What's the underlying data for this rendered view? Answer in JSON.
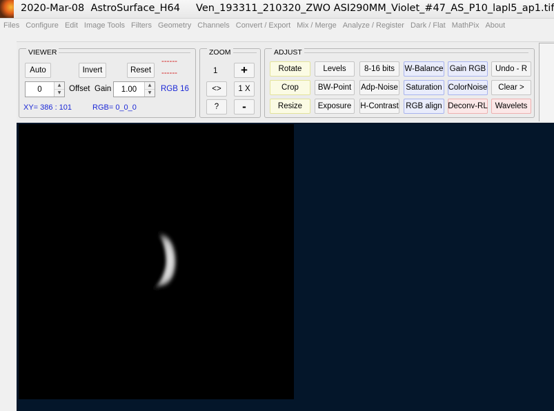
{
  "window": {
    "title": "2020-Mar-08  AstroSurface_H64     Ven_193311_210320_ZWO ASI290MM_Violet_#47_AS_P10_lapl5_ap1.tif"
  },
  "menu": [
    "Files",
    "Configure",
    "Edit",
    "Image Tools",
    "Filters",
    "Geometry",
    "Channels",
    "Convert / Export",
    "Mix / Merge",
    "Analyze / Register",
    "Dark / Flat",
    "MathPix",
    "About"
  ],
  "viewer": {
    "title": "VIEWER",
    "auto": "Auto",
    "invert": "Invert",
    "reset": "Reset",
    "dash1": "------",
    "dash2": "------",
    "offset_value": "0",
    "offset_label": "Offset",
    "gain_label": "Gain",
    "gain_value": "1.00",
    "rgb_mode": "RGB 16",
    "xy_readout": "XY=  386 : 101",
    "rgb_readout": "RGB=  0_0_0"
  },
  "zoom": {
    "title": "ZOOM",
    "level": "1",
    "plus": "+",
    "fit": "<>",
    "one_x": "1 X",
    "help": "?",
    "minus": "-"
  },
  "adjust": {
    "title": "ADJUST",
    "buttons": [
      "Rotate",
      "Levels",
      "8-16 bits",
      "W-Balance",
      "Gain RGB",
      "Undo - R",
      "Crop",
      "BW-Point",
      "Adp-Noise",
      "Saturation",
      "ColorNoise",
      "Clear >",
      "Resize",
      "Exposure",
      "H-Contrast",
      "RGB align",
      "Deconv-RL",
      "Wavelets"
    ]
  },
  "colors": {
    "viewport_background": "#04162a",
    "image_background": "#000000",
    "readout_blue": "#1a27d6",
    "dash_red": "#d21b1b"
  }
}
